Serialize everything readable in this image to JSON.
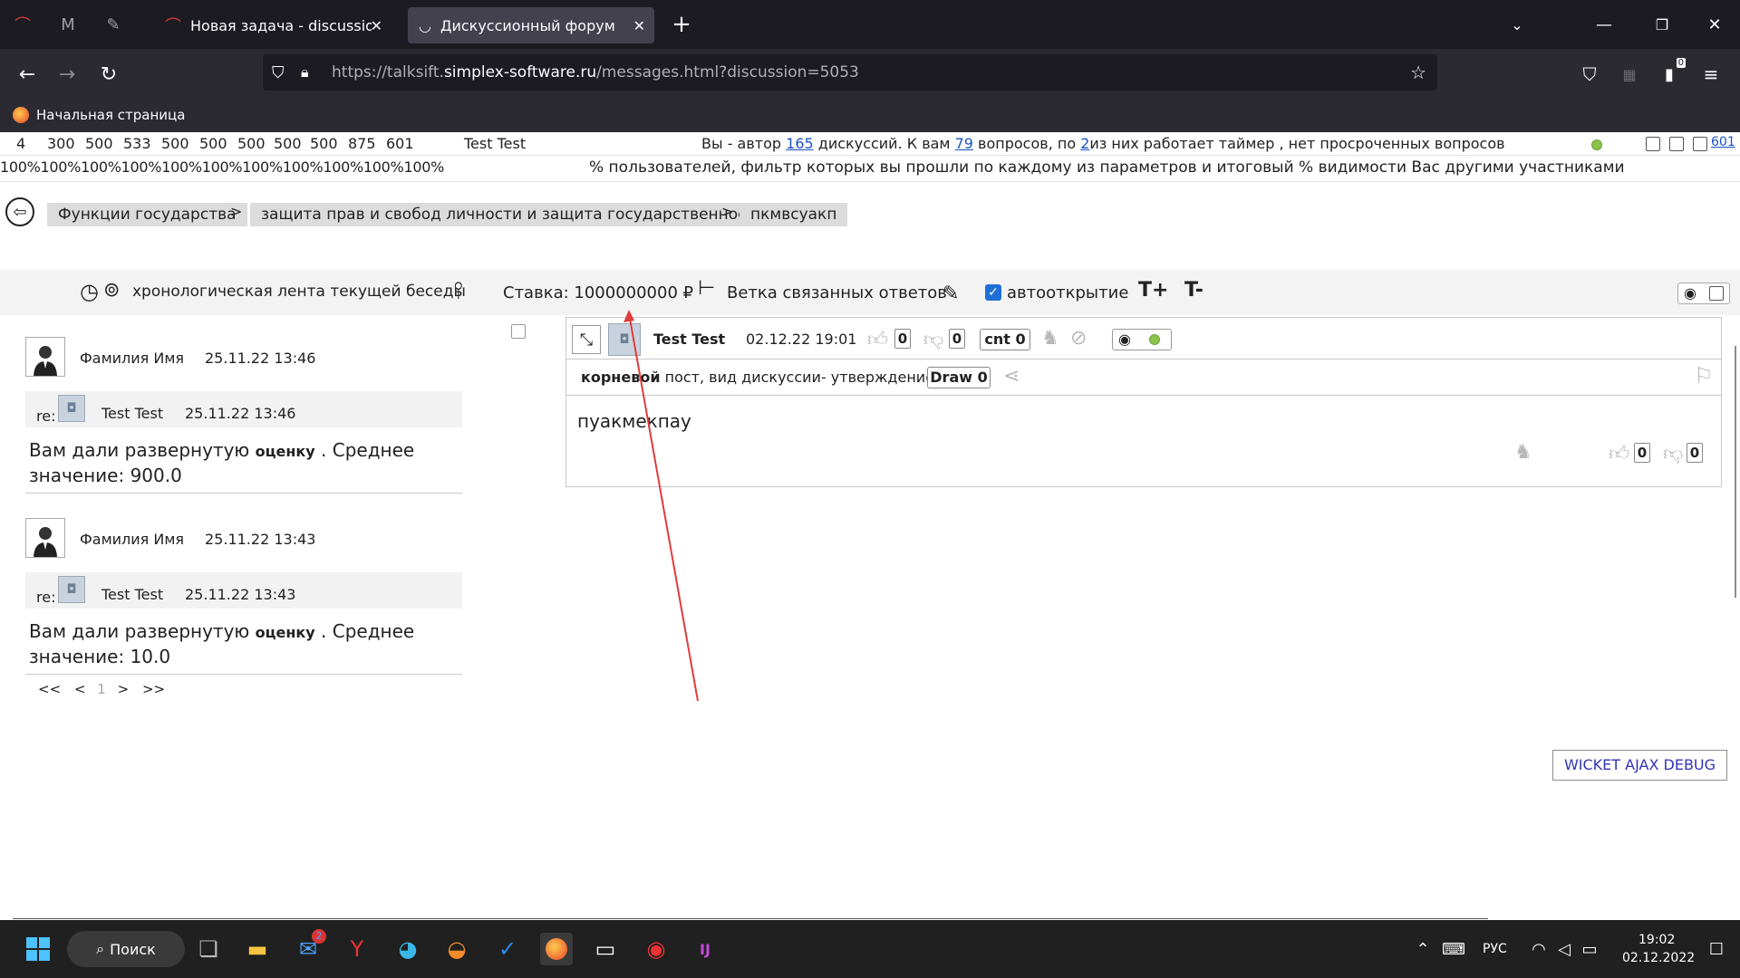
{
  "browser": {
    "tabs": [
      {
        "title": "Новая задача - discussion - Re",
        "active": false
      },
      {
        "title": "Дискуссионный форум",
        "active": true
      }
    ],
    "new_tab": "+",
    "url_prefix": "https://talksift.",
    "url_domain": "simplex-software.ru",
    "url_suffix": "/messages.html?discussion=5053",
    "bookmark": "Начальная страница",
    "ext_badge": "0"
  },
  "stats": {
    "numbers": [
      "4",
      "300",
      "500",
      "533",
      "500",
      "500",
      "500",
      "500",
      "500",
      "875",
      "601"
    ],
    "user": "Test Test",
    "summary_pre": "Вы - автор",
    "authored": "165",
    "summary_mid": "дискуссий. К вам",
    "questions": "79",
    "summary_mid2": "вопросов, по",
    "timer_count": "2",
    "summary_post": "из них работает таймер , нет просроченных вопросов",
    "corner_value": "601",
    "percents": [
      "100%",
      "100%",
      "100%",
      "100%",
      "100%",
      "100%",
      "100%",
      "100%",
      "100%",
      "100%",
      "100%"
    ],
    "percent_desc": "% пользователей, фильтр которых вы прошли по каждому из параметров и итоговый % видимости Вас другими участниками"
  },
  "breadcrumbs": {
    "items": [
      "Функции государства",
      "защита прав и свобод личности и защита государственности",
      "пкмвсуакп"
    ],
    "separator": ">"
  },
  "toolbar": {
    "chrono": "хронологическая лента текущей беседы",
    "stake": "Ставка: 1000000000 ₽",
    "branch": "Ветка связанных ответов",
    "autoopen": "автооткрытие",
    "font_plus": "T+",
    "font_minus": "T-"
  },
  "feed": [
    {
      "author": "Фамилия Имя",
      "time": "25.11.22 13:46",
      "re_label": "re:",
      "re_author": "Test Test",
      "re_time": "25.11.22 13:46",
      "text_a": "Вам дали развернутую",
      "text_b": "оценку",
      "text_c": ". Среднее значение: 900.0"
    },
    {
      "author": "Фамилия Имя",
      "time": "25.11.22 13:43",
      "re_label": "re:",
      "re_author": "Test Test",
      "re_time": "25.11.22 13:43",
      "text_a": "Вам дали развернутую",
      "text_b": "оценку",
      "text_c": ". Среднее значение: 10.0"
    }
  ],
  "pager": {
    "first": "<<",
    "prev": "<",
    "current": "1",
    "next": ">",
    "last": ">>"
  },
  "post": {
    "author": "Test Test",
    "time": "02.12.22 19:01",
    "likes": "0",
    "dislikes": "0",
    "cnt_label": "cnt 0",
    "type_bold": "корневой",
    "type_rest": "пост, вид дискуссии- утверждение",
    "draw_label": "Draw 0",
    "body": "пуакмекпау",
    "body_likes": "0",
    "body_dislikes": "0"
  },
  "debug_button": "WICKET AJAX DEBUG",
  "taskbar": {
    "search": "Поиск",
    "mail_badge": "2",
    "lang": "РУС",
    "time": "19:02",
    "date": "02.12.2022"
  },
  "colors": {
    "arrow": "#e03c3c",
    "link": "#1a55c4",
    "status_dot": "#8bc34a"
  }
}
